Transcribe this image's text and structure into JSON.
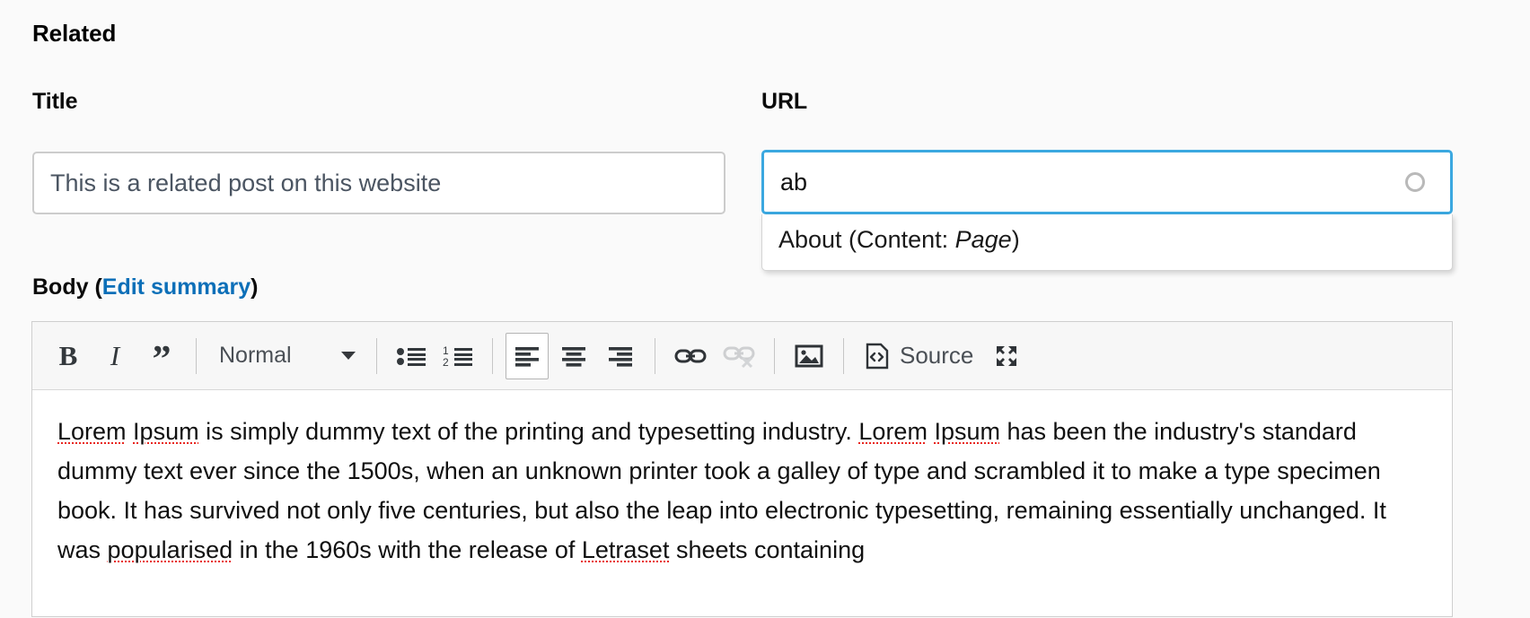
{
  "section": {
    "heading": "Related"
  },
  "fields": {
    "title": {
      "label": "Title",
      "value": "This is a related post on this website",
      "placeholder": "This is a related post on this website"
    },
    "url": {
      "label": "URL",
      "value": "ab",
      "placeholder": "",
      "throbber_icon": "loading-circle-icon",
      "focus_color": "#3ba8e0"
    }
  },
  "autocomplete": {
    "items": [
      {
        "prefix": "About (Content: ",
        "emphasis": "Page",
        "suffix": ")"
      }
    ]
  },
  "body_field": {
    "label": "Body (",
    "link_label": "Edit summary",
    "label_close": ")",
    "link_color": "#0c6fb8"
  },
  "editor": {
    "toolbar": {
      "bold": {
        "label": "B",
        "name": "bold-button",
        "active": false
      },
      "italic": {
        "label": "I",
        "name": "italic-button",
        "active": false
      },
      "blockquote": {
        "label": "”",
        "name": "blockquote-button",
        "active": false
      },
      "format": {
        "label": "Normal",
        "name": "paragraph-format-dropdown"
      },
      "bulleted_list": {
        "label": "Bulleted list",
        "name": "bulleted-list-button"
      },
      "numbered_list": {
        "label": "Numbered list",
        "name": "numbered-list-button"
      },
      "align_left": {
        "label": "Align left",
        "name": "align-left-button",
        "active": true
      },
      "align_center": {
        "label": "Align center",
        "name": "align-center-button",
        "active": false
      },
      "align_right": {
        "label": "Align right",
        "name": "align-right-button",
        "active": false
      },
      "link": {
        "label": "Link",
        "name": "link-button",
        "disabled": false
      },
      "unlink": {
        "label": "Unlink",
        "name": "unlink-button",
        "disabled": true
      },
      "image": {
        "label": "Image",
        "name": "image-button"
      },
      "source": {
        "label": "Source",
        "name": "source-button"
      },
      "maximize": {
        "label": "Maximize",
        "name": "maximize-button"
      }
    },
    "content": {
      "paragraph_segments": [
        {
          "text": "Lorem",
          "misspelled": true
        },
        {
          "text": " ",
          "misspelled": false
        },
        {
          "text": "Ipsum",
          "misspelled": true
        },
        {
          "text": " is simply dummy text of the printing and typesetting industry. ",
          "misspelled": false
        },
        {
          "text": "Lorem",
          "misspelled": true
        },
        {
          "text": " ",
          "misspelled": false
        },
        {
          "text": "Ipsum",
          "misspelled": true
        },
        {
          "text": " has been the industry's standard dummy text ever since the 1500s, when an unknown printer took a galley of type and scrambled it to make a type specimen book. It has survived not only five centuries, but also the leap into electronic typesetting, remaining essentially unchanged. It was ",
          "misspelled": false
        },
        {
          "text": "popularised",
          "misspelled": true
        },
        {
          "text": " in the 1960s with the release of ",
          "misspelled": false
        },
        {
          "text": "Letraset",
          "misspelled": true
        },
        {
          "text": " sheets containing",
          "misspelled": false
        }
      ]
    }
  }
}
